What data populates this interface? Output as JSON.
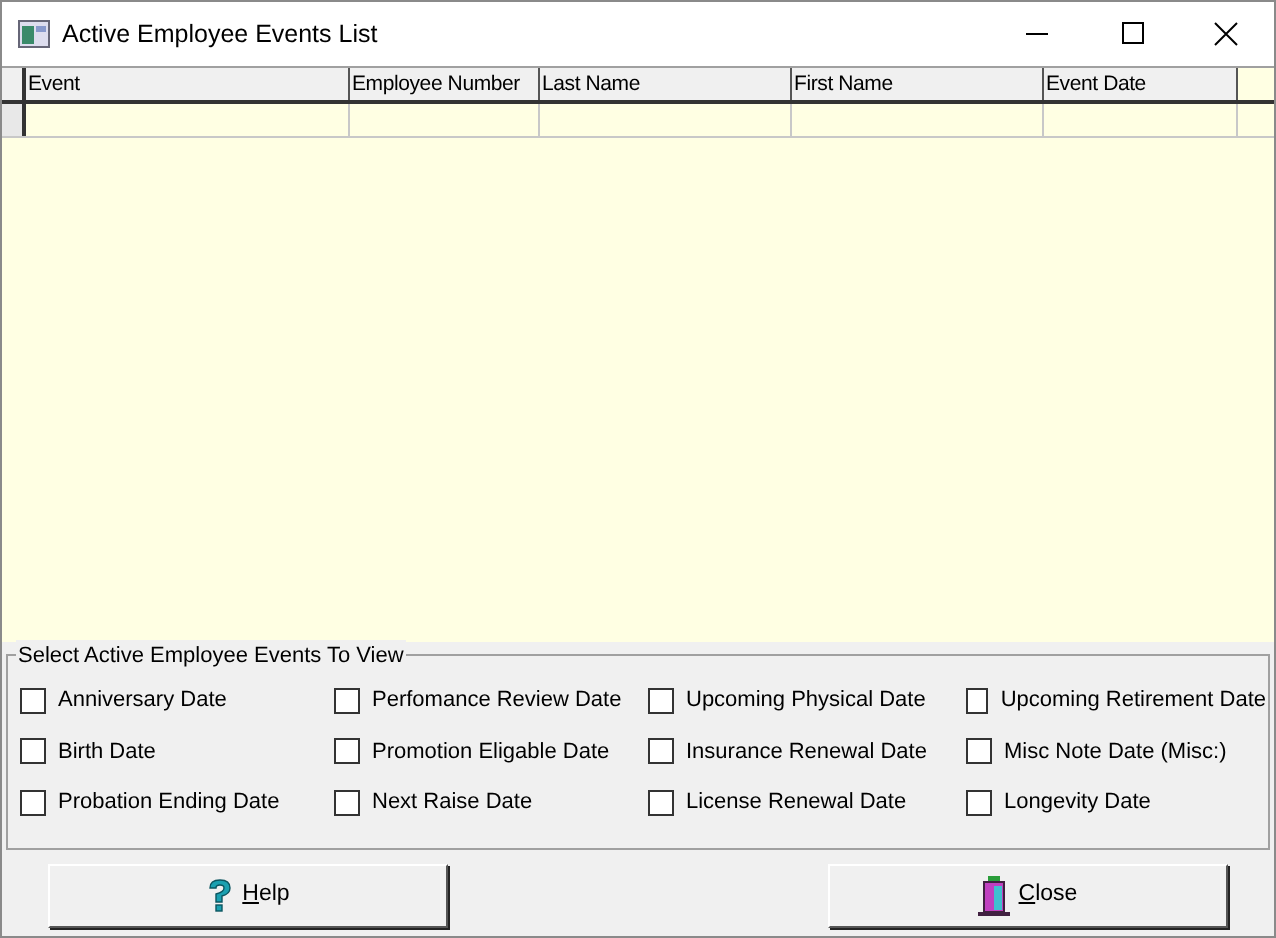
{
  "window": {
    "title": "Active Employee Events List"
  },
  "table": {
    "columns": [
      "Event",
      "Employee Number",
      "Last Name",
      "First Name",
      "Event Date"
    ]
  },
  "events_group": {
    "title": "Select Active Employee Events To View",
    "options": [
      {
        "label": "Anniversary Date",
        "checked": false
      },
      {
        "label": "Perfomance Review Date",
        "checked": false
      },
      {
        "label": "Upcoming Physical Date",
        "checked": false
      },
      {
        "label": "Upcoming Retirement Date",
        "checked": false
      },
      {
        "label": "Birth Date",
        "checked": false
      },
      {
        "label": "Promotion Eligable Date",
        "checked": false
      },
      {
        "label": "Insurance Renewal Date",
        "checked": false
      },
      {
        "label": "Misc Note Date (Misc:)",
        "checked": false
      },
      {
        "label": "Probation Ending Date",
        "checked": false
      },
      {
        "label": "Next Raise Date",
        "checked": false
      },
      {
        "label": "License Renewal Date",
        "checked": false
      },
      {
        "label": "Longevity Date",
        "checked": false
      }
    ]
  },
  "buttons": [
    {
      "kind": "help",
      "label": "Help"
    },
    {
      "kind": "close",
      "label": "Close"
    }
  ]
}
